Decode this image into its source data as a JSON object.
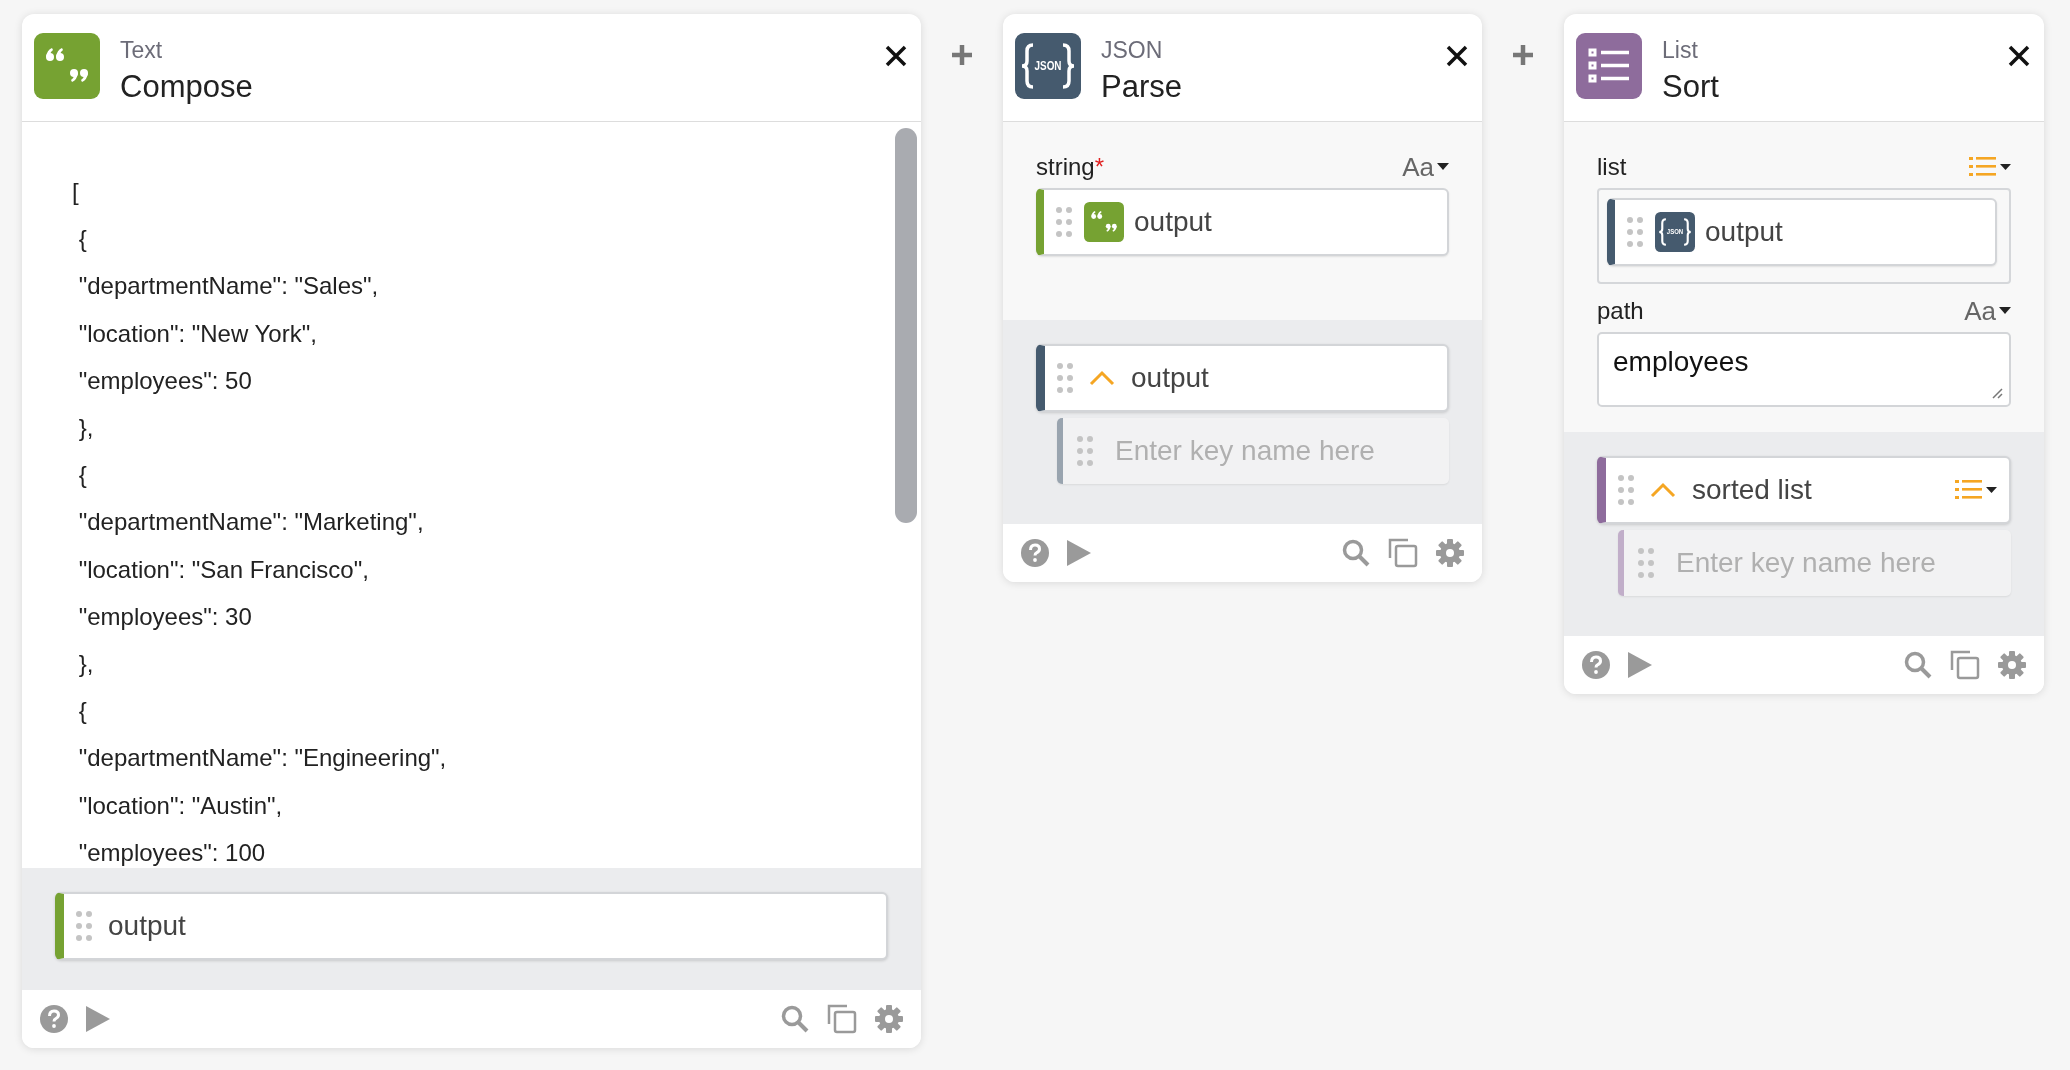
{
  "cards": [
    {
      "color": "#76a232",
      "icon": {
        "kind": "quote"
      },
      "category": "Text",
      "title": "Compose",
      "content_lines": [
        "[",
        " {",
        " \"departmentName\": \"Sales\",",
        " \"location\": \"New York\",",
        " \"employees\": 50",
        " },",
        " {",
        " \"departmentName\": \"Marketing\",",
        " \"location\": \"San Francisco\",",
        " \"employees\": 30",
        " },",
        " {",
        " \"departmentName\": \"Engineering\",",
        " \"location\": \"Austin\",",
        " \"employees\": 100"
      ],
      "outputs": [
        {
          "label": "output"
        }
      ]
    },
    {
      "color": "#455a6e",
      "icon": {
        "kind": "json",
        "text": "JSON"
      },
      "category": "JSON",
      "title": "Parse",
      "inputs": [
        {
          "kind": "chip",
          "label": "string",
          "required_mark": "*",
          "type": {
            "kind": "text",
            "label": "Aa"
          },
          "framed": false,
          "source": {
            "icon": {
              "kind": "quote"
            },
            "color": "#76a232",
            "label": "output"
          }
        }
      ],
      "outputs": [
        {
          "label": "output",
          "expanded": true,
          "key_placeholder": "Enter key name here"
        }
      ]
    },
    {
      "color": "#8e6c9c",
      "icon": {
        "kind": "list"
      },
      "category": "List",
      "title": "Sort",
      "inputs": [
        {
          "kind": "chip",
          "label": "list",
          "type": {
            "kind": "list"
          },
          "framed": true,
          "source": {
            "icon": {
              "kind": "json",
              "text": "JSON"
            },
            "color": "#455a6e",
            "label": "output"
          }
        },
        {
          "kind": "text",
          "label": "path",
          "type": {
            "kind": "text",
            "label": "Aa"
          },
          "value": "employees"
        }
      ],
      "outputs": [
        {
          "label": "sorted list",
          "expanded": true,
          "type": {
            "kind": "list"
          },
          "key_placeholder": "Enter key name here"
        }
      ]
    }
  ]
}
